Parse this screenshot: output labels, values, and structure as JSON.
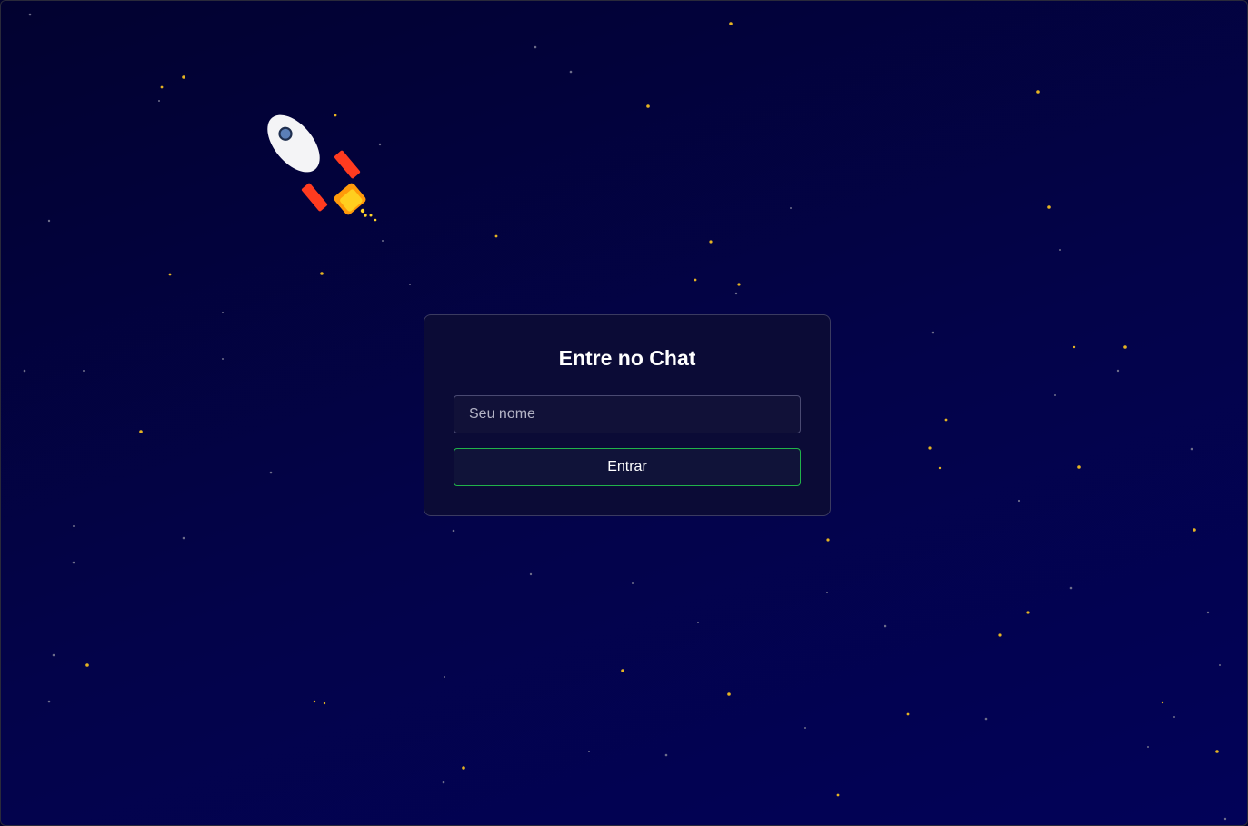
{
  "login": {
    "title": "Entre no Chat",
    "name_placeholder": "Seu nome",
    "name_value": "",
    "enter_label": "Entrar"
  },
  "icons": {
    "rocket": "rocket-icon"
  },
  "colors": {
    "background": "#02023a",
    "card": "#0b0b36",
    "button_border": "#21b24a",
    "star": "#e6b422"
  }
}
